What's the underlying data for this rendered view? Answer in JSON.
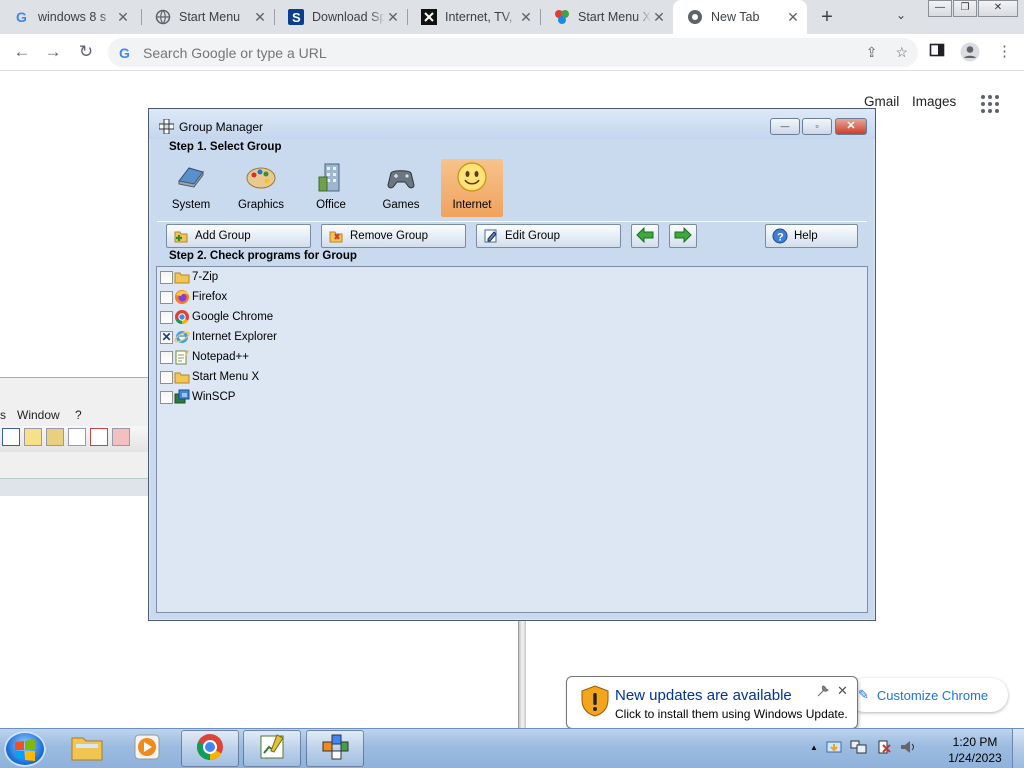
{
  "browser": {
    "tabs": [
      {
        "title": "windows 8 s",
        "icon": "google-icon"
      },
      {
        "title": "Start Menu",
        "icon": "globe-icon"
      },
      {
        "title": "Download Sp",
        "icon": "softpedia-icon"
      },
      {
        "title": "Internet, TV,",
        "icon": "x-icon"
      },
      {
        "title": "Start Menu X",
        "icon": "startmenux-icon"
      },
      {
        "title": "New Tab",
        "icon": "chrome-icon"
      }
    ],
    "new_tab_symbol": "+",
    "tab_menu_symbol": "⌄",
    "window_controls": {
      "minimize": "—",
      "restore": "❐",
      "close": "✕"
    },
    "omnibox_placeholder": "Search Google or type a URL",
    "ntp": {
      "gmail": "Gmail",
      "images": "Images",
      "customize": "Customize Chrome"
    }
  },
  "background_app": {
    "menu": [
      "s",
      "Window",
      "?"
    ]
  },
  "group_manager": {
    "title": "Group Manager",
    "controls": {
      "minimize": "—",
      "maximize": "▫",
      "close": "✕"
    },
    "step1": "Step 1. Select Group",
    "groups": [
      {
        "label": "System",
        "icon": "laptop-icon",
        "selected": false
      },
      {
        "label": "Graphics",
        "icon": "palette-icon",
        "selected": false
      },
      {
        "label": "Office",
        "icon": "office-building-icon",
        "selected": false
      },
      {
        "label": "Games",
        "icon": "gamepad-icon",
        "selected": false
      },
      {
        "label": "Internet",
        "icon": "smiley-icon",
        "selected": true
      }
    ],
    "buttons": {
      "add": "Add Group",
      "remove": "Remove Group",
      "edit": "Edit Group",
      "help": "Help"
    },
    "step2": "Step 2. Check programs for Group",
    "programs": [
      {
        "name": "7-Zip",
        "icon": "folder-icon",
        "checked": false
      },
      {
        "name": "Firefox",
        "icon": "firefox-icon",
        "checked": false
      },
      {
        "name": "Google Chrome",
        "icon": "chrome-icon",
        "checked": false
      },
      {
        "name": "Internet Explorer",
        "icon": "internet-explorer-icon",
        "checked": true
      },
      {
        "name": "Notepad++",
        "icon": "notepad-icon",
        "checked": false
      },
      {
        "name": "Start Menu X",
        "icon": "folder-icon",
        "checked": false
      },
      {
        "name": "WinSCP",
        "icon": "winscp-icon",
        "checked": false
      }
    ],
    "check_mark": "✕"
  },
  "notification": {
    "title": "New updates are available",
    "body": "Click to install them using Windows Update.",
    "close": "✕"
  },
  "taskbar": {
    "clock_time": "1:20 PM",
    "clock_date": "1/24/2023",
    "tray_up": "▲",
    "colors": {
      "taskbar": "#9cbbe0",
      "selected_group": "#f0a25d",
      "window": "#c9d9ee"
    }
  }
}
